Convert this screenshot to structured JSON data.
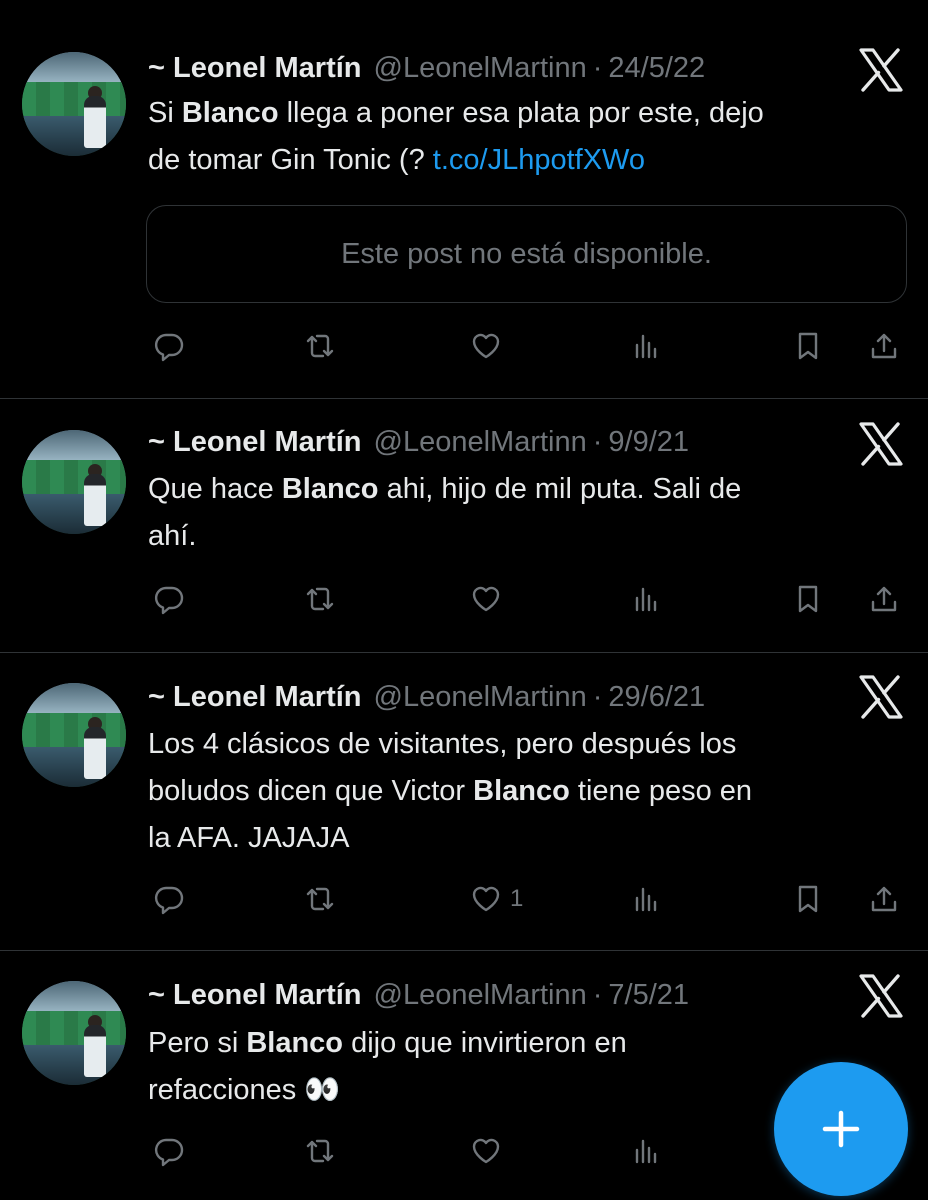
{
  "tweets": [
    {
      "name": "~ Leonel Martín",
      "handle": "@LeonelMartinn",
      "dot": "·",
      "date": "24/5/22",
      "lines": [
        [
          {
            "t": "Si "
          },
          {
            "t": "Blanco",
            "b": true
          },
          {
            "t": " llega a poner esa plata por este, dejo"
          }
        ],
        [
          {
            "t": "de tomar Gin Tonic (? "
          },
          {
            "t": "t.co/JLhpotfXWo",
            "link": true
          }
        ]
      ],
      "quote": "Este post no está disponible.",
      "likes": ""
    },
    {
      "name": "~ Leonel Martín",
      "handle": "@LeonelMartinn",
      "dot": "·",
      "date": "9/9/21",
      "lines": [
        [
          {
            "t": "Que hace "
          },
          {
            "t": "Blanco",
            "b": true
          },
          {
            "t": " ahi, hijo de mil puta. Sali de"
          }
        ],
        [
          {
            "t": "ahí."
          }
        ]
      ],
      "likes": ""
    },
    {
      "name": "~ Leonel Martín",
      "handle": "@LeonelMartinn",
      "dot": "·",
      "date": "29/6/21",
      "lines": [
        [
          {
            "t": "Los 4 clásicos de visitantes, pero después los"
          }
        ],
        [
          {
            "t": "boludos dicen que Victor "
          },
          {
            "t": "Blanco",
            "b": true
          },
          {
            "t": " tiene peso en"
          }
        ],
        [
          {
            "t": "la AFA. JAJAJA"
          }
        ]
      ],
      "likes": "1"
    },
    {
      "name": "~ Leonel Martín",
      "handle": "@LeonelMartinn",
      "dot": "·",
      "date": "7/5/21",
      "lines": [
        [
          {
            "t": "Pero si "
          },
          {
            "t": "Blanco",
            "b": true
          },
          {
            "t": " dijo que invirtieron en"
          }
        ],
        [
          {
            "t": "refacciones 👀"
          }
        ]
      ],
      "likes": ""
    }
  ],
  "icons": {
    "actions": [
      "reply-icon",
      "repost-icon",
      "like-icon",
      "views-icon",
      "bookmark-icon",
      "share-icon"
    ],
    "brand": "x-logo-icon",
    "compose": "plus-icon"
  },
  "colors": {
    "background": "#000000",
    "text": "#e7e9ea",
    "muted": "#71767b",
    "link": "#1d9bf0",
    "fab": "#1d9bf0",
    "divider": "#2f3336"
  }
}
